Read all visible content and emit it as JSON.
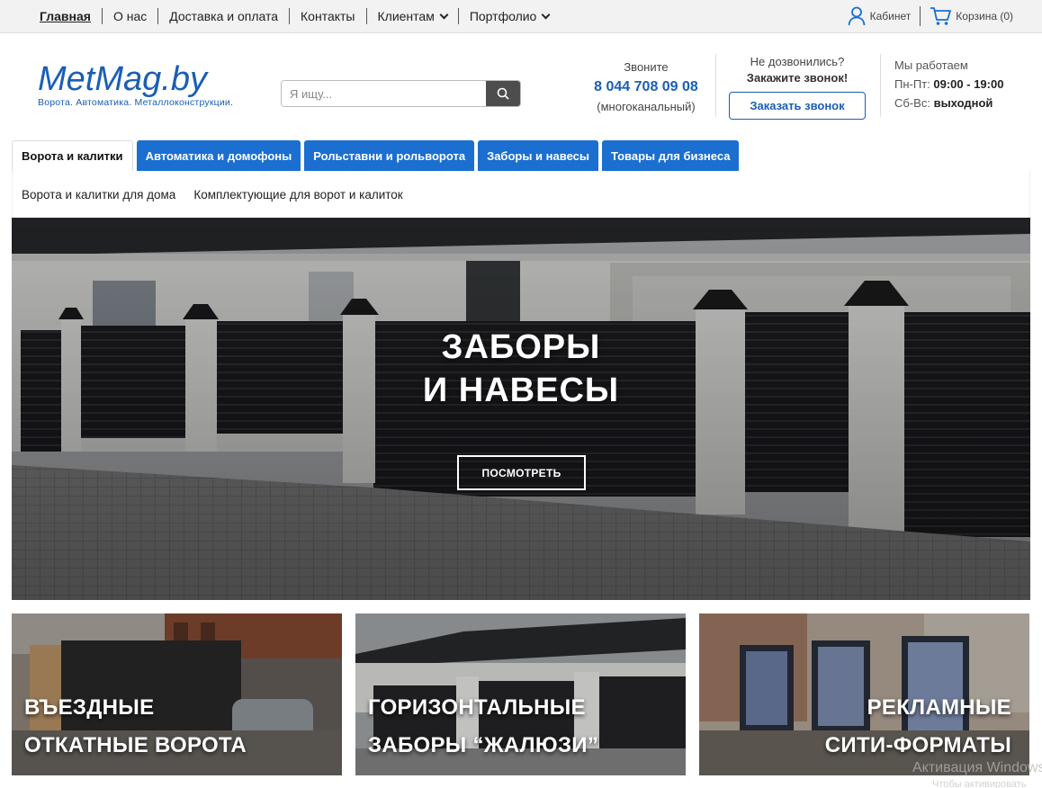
{
  "topnav": {
    "items": [
      {
        "label": "Главная"
      },
      {
        "label": "О нас"
      },
      {
        "label": "Доставка и оплата"
      },
      {
        "label": "Контакты"
      },
      {
        "label": "Клиентам"
      },
      {
        "label": "Портфолио"
      }
    ],
    "cabinet_label": "Кабинет",
    "cart_label": "Корзина (0)"
  },
  "header": {
    "logo_text": "MetMag.by",
    "logo_tagline": "Ворота. Автоматика. Металлоконструкции.",
    "search_placeholder": "Я ищу...",
    "phone_caption": "Звоните",
    "phone_number": "8 044 708 09 08",
    "phone_note": "(многоканальный)",
    "callback_question": "Не дозвонились?",
    "callback_prompt": "Закажите звонок!",
    "callback_button": "Заказать звонок",
    "hours_title": "Мы работаем",
    "hours_weekdays_label": "Пн-Пт:",
    "hours_weekdays_value": "09:00 - 19:00",
    "hours_weekend_label": "Сб-Вс:",
    "hours_weekend_value": "выходной"
  },
  "tabs": [
    {
      "label": "Ворота и калитки",
      "active": true
    },
    {
      "label": "Автоматика и домофоны",
      "active": false
    },
    {
      "label": "Рольставни и рольворота",
      "active": false
    },
    {
      "label": "Заборы и навесы",
      "active": false
    },
    {
      "label": "Товары для бизнеса",
      "active": false
    }
  ],
  "subnav": [
    {
      "label": "Ворота и калитки для дома"
    },
    {
      "label": "Комплектующие для ворот и калиток"
    }
  ],
  "hero": {
    "title_line1": "ЗАБОРЫ",
    "title_line2": "И НАВЕСЫ",
    "cta_label": "ПОСМОТРЕТЬ"
  },
  "cards": [
    {
      "line1": "ВЪЕЗДНЫЕ",
      "line2": "ОТКАТНЫЕ ВОРОТА"
    },
    {
      "line1": "ГОРИЗОНТАЛЬНЫЕ",
      "line2": "ЗАБОРЫ “ЖАЛЮЗИ”"
    },
    {
      "line1": "РЕКЛАМНЫЕ",
      "line2": "СИТИ-ФОРМАТЫ"
    }
  ],
  "os_watermark": {
    "line1": "Активация Windows",
    "line2": "Чтобы активировать"
  },
  "colors": {
    "brand_blue": "#1a5fb4",
    "tab_blue": "#1a6fd0",
    "search_button": "#4d4d4d"
  }
}
